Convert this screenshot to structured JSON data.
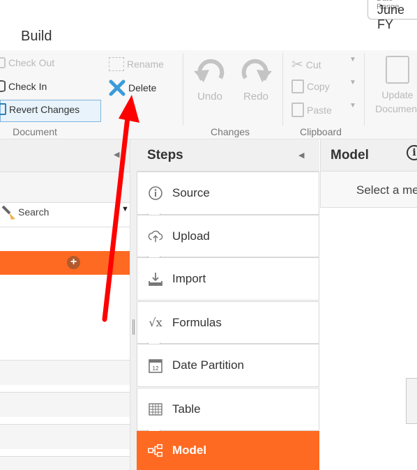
{
  "header": {
    "title": "Build",
    "date_label": "Date Range",
    "date_value": "June FY"
  },
  "ribbon": {
    "document": {
      "check_out": "Check Out",
      "check_in": "Check In",
      "revert_changes": "Revert Changes",
      "rename": "Rename",
      "delete": "Delete",
      "group_label": "Document"
    },
    "changes": {
      "undo": "Undo",
      "redo": "Redo",
      "group_label": "Changes"
    },
    "clipboard": {
      "cut": "Cut",
      "copy": "Copy",
      "paste": "Paste",
      "group_label": "Clipboard"
    },
    "update_document": "Update Document"
  },
  "left_panel": {
    "search_placeholder": "Search"
  },
  "steps": {
    "title": "Steps",
    "items": [
      {
        "label": "Source",
        "icon": "info-icon"
      },
      {
        "label": "Upload",
        "icon": "cloud-upload-icon"
      },
      {
        "label": "Import",
        "icon": "download-tray-icon"
      },
      {
        "label": "Formulas",
        "icon": "sqrt-x-icon"
      },
      {
        "label": "Date Partition",
        "icon": "calendar-icon"
      },
      {
        "label": "Table",
        "icon": "table-icon"
      },
      {
        "label": "Model",
        "icon": "model-hierarchy-icon"
      }
    ],
    "active": "Model"
  },
  "model": {
    "title": "Model",
    "message": "Select a me"
  },
  "colors": {
    "accent": "#ff6a22",
    "delete_icon": "#3a9bd9",
    "annotation_arrow": "#ff0000"
  }
}
